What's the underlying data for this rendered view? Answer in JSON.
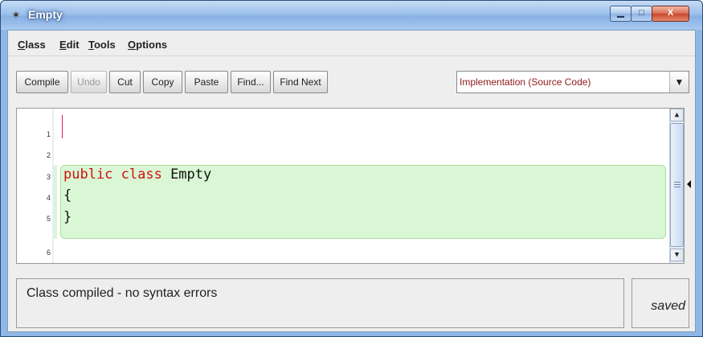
{
  "window": {
    "title": "Empty",
    "controls": {
      "minimize": "▁",
      "maximize": "□",
      "close": "X"
    }
  },
  "menubar": {
    "items": [
      "Class",
      "Edit",
      "Tools",
      "Options"
    ]
  },
  "toolbar": {
    "buttons": [
      {
        "label": "Compile",
        "enabled": true
      },
      {
        "label": "Undo",
        "enabled": false
      },
      {
        "label": "Cut",
        "enabled": true
      },
      {
        "label": "Copy",
        "enabled": true
      },
      {
        "label": "Paste",
        "enabled": true
      },
      {
        "label": "Find...",
        "enabled": true
      },
      {
        "label": "Find Next",
        "enabled": true
      }
    ],
    "view_select": {
      "selected": "Implementation (Source Code)",
      "arrow_icon": "chevron-down-icon"
    }
  },
  "editor": {
    "line_numbers": [
      "1",
      "2",
      "3",
      "4",
      "5",
      "6"
    ],
    "code": {
      "line3_kw": "public class",
      "line3_name": " Empty",
      "line4": "{",
      "line5": "}"
    },
    "keyword_color": "#d01010",
    "scope_color": "#d9f7d4"
  },
  "status": {
    "message": "Class compiled - no syntax errors",
    "saved": "saved"
  }
}
